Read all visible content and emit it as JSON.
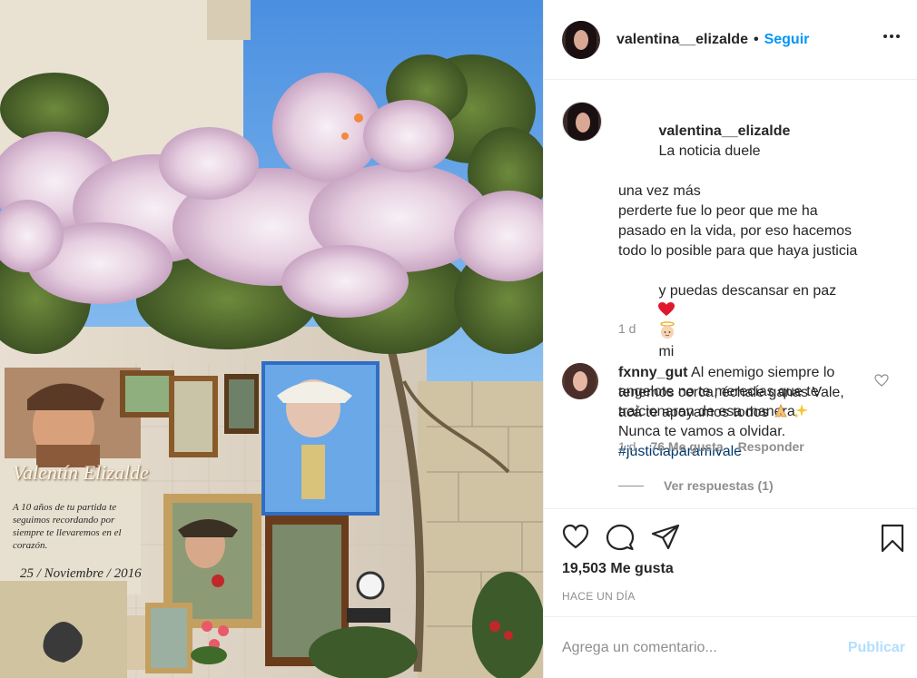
{
  "post": {
    "image_alt": "Shrine with bougainvillea and framed portraits",
    "photo_texts": {
      "banner_name": "Valentín Elizalde",
      "banner_message": "A 10 años de tu partida te seguimos recordando por siempre te llevaremos en el corazón.",
      "banner_date": "25 / Noviembre / 2016"
    }
  },
  "header": {
    "username": "valentina__elizalde",
    "separator": "•",
    "follow_label": "Seguir",
    "more_icon": "more-options-icon"
  },
  "caption": {
    "username": "valentina__elizalde",
    "lines": [
      "La noticia duele",
      "una vez más",
      "perderte fue lo peor que me ha",
      "pasado en la vida, por eso hacemos",
      "todo lo posible para que haya justicia",
      "y puedas descansar en paz",
      "mi",
      "angelote no te merecías que te",
      "traicionaran de esa manera",
      "Nunca te vamos a olvidar."
    ],
    "hashtag": "#justiciaparamivale",
    "time": "1 d"
  },
  "comment": {
    "username": "fxnny_gut",
    "text_lines": [
      "Al enemigo siempre lo",
      "tenemos cerca, échale ganas Vale,",
      "acá te apoyamos todos"
    ],
    "time": "1 d",
    "likes": "76 Me gusta",
    "reply_label": "Responder",
    "view_replies": "Ver respuestas (1)"
  },
  "actions": {
    "icons": [
      "heart-icon",
      "comment-icon",
      "share-icon",
      "save-icon"
    ]
  },
  "likes_text": "19,503 Me gusta",
  "posted_time": "HACE UN DÍA",
  "comment_box": {
    "placeholder": "Agrega un comentario...",
    "publish_label": "Publicar"
  },
  "colors": {
    "link_blue": "#0095f6",
    "publish_disabled": "#b2dffc",
    "hashtag": "#00376b",
    "muted": "#8e8e8e",
    "text": "#262626"
  }
}
